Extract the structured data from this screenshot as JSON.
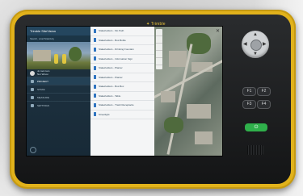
{
  "device": {
    "brand": "✦ Trimble"
  },
  "app": {
    "header_title": "Trimble  SiteVision",
    "header_subtitle": "Sketch, vixar/Staktivity",
    "user": {
      "name": "Jo tool cam",
      "detail": "Nor Wixon"
    },
    "menu": [
      {
        "label": "PROJECT",
        "selected": true
      },
      {
        "label": "STAKE",
        "selected": false
      },
      {
        "label": "MEASURE",
        "selected": false
      },
      {
        "label": "SETTINGS",
        "selected": false
      }
    ],
    "list_items": [
      "Stakeholders - Mo Path",
      "Stakeholders - Bus Bottle",
      "Stakeholders - Drinking Fountain",
      "Stakeholders - Information Sign",
      "Stakeholders - Planter",
      "Stakeholders - Planter",
      "Stakeholders - Bus Box",
      "Stakeholders - Table",
      "Stakeholders - Trash Receptacle",
      "Streetlight"
    ]
  },
  "keys": {
    "f_keys": [
      "F1",
      "F2",
      "F3",
      "F4"
    ],
    "power_label": "⏻"
  },
  "icons": {
    "dpad": "dpad-icon",
    "power": "power-icon",
    "close": "close-icon"
  },
  "colors": {
    "device_yellow": "#e1b21b",
    "power_green": "#2fb04b",
    "app_blue": "#24465e"
  }
}
